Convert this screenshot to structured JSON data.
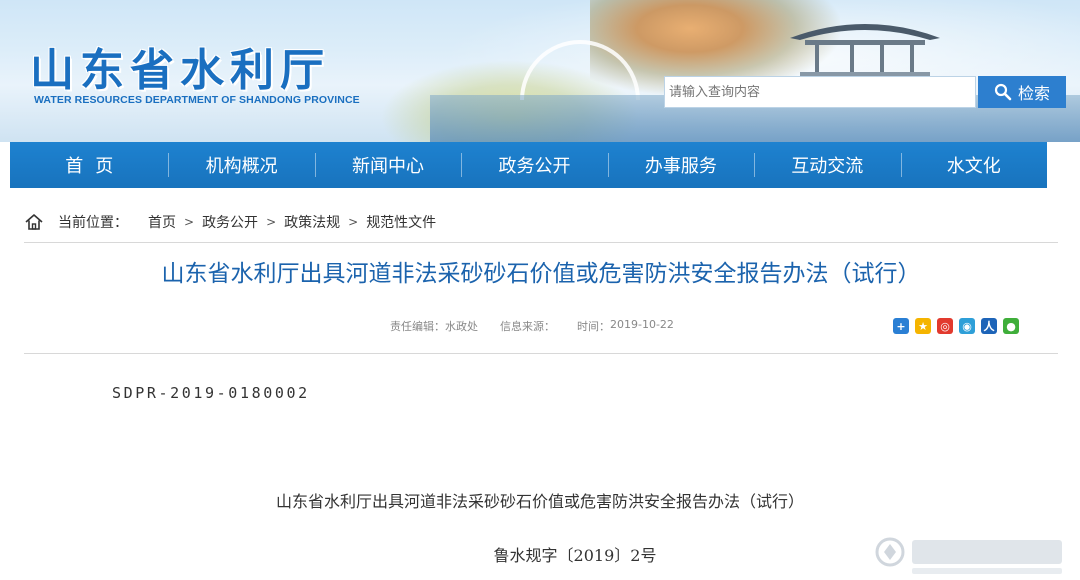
{
  "header": {
    "site_title": "山东省水利厅",
    "site_subtitle": "WATER RESOURCES DEPARTMENT OF SHANDONG PROVINCE",
    "search_placeholder": "请输入查询内容",
    "search_button": "检索"
  },
  "nav": {
    "items": [
      "首页",
      "机构概况",
      "新闻中心",
      "政务公开",
      "办事服务",
      "互动交流",
      "水文化"
    ]
  },
  "breadcrumb": {
    "label": "当前位置：",
    "items": [
      "首页",
      "政务公开",
      "政策法规",
      "规范性文件"
    ],
    "separator": ">"
  },
  "article": {
    "title": "山东省水利厅出具河道非法采砂砂石价值或危害防洪安全报告办法（试行）",
    "meta": {
      "editor_label": "责任编辑：",
      "editor": "水政处",
      "source_label": "信息来源：",
      "source": "",
      "time_label": "时间：",
      "time": "2019-10-22"
    },
    "share_icons": [
      "share-more-icon",
      "qzone-icon",
      "weibo-icon",
      "tencent-weibo-icon",
      "renren-icon",
      "wechat-icon"
    ]
  },
  "document": {
    "code": "SDPR-2019-0180002",
    "title": "山东省水利厅出具河道非法采砂砂石价值或危害防洪安全报告办法（试行）",
    "number": "鲁水规字〔2019〕2号"
  },
  "colors": {
    "brand_blue": "#1a6fc0",
    "nav_blue": "#1e82d0",
    "title_blue": "#1b63ad",
    "meta_gray": "#888888"
  }
}
